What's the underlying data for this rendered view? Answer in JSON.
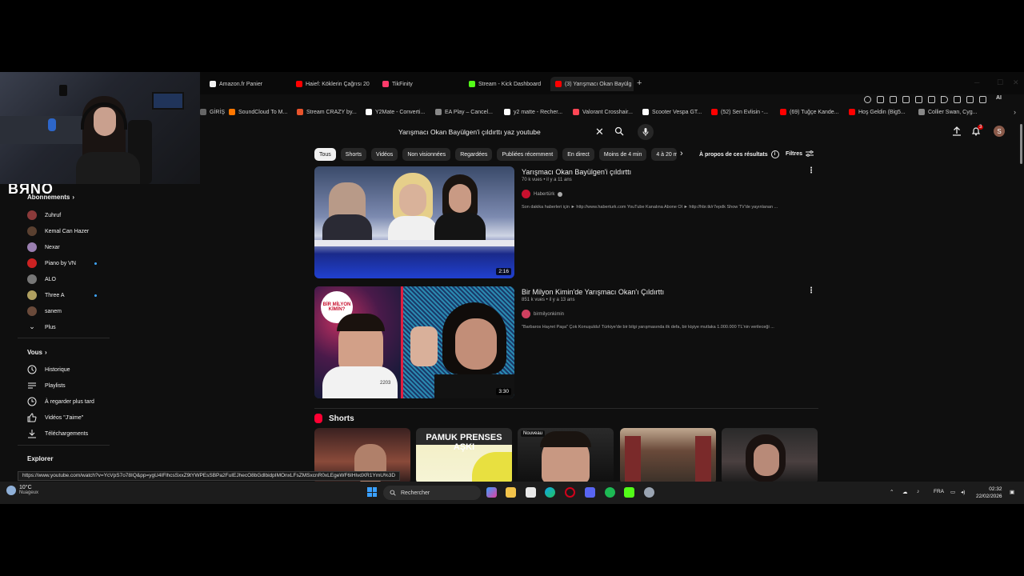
{
  "browser": {
    "tabs": [
      {
        "label": "Amazon.fr Panier",
        "color": "#f3f3f3"
      },
      {
        "label": "Haief: Köklerin Çağrısı 20",
        "color": "#ff0000"
      },
      {
        "label": "TikFinity",
        "color": "#ff3b6b"
      },
      {
        "label": "Stream - Kick Dashboard",
        "color": "#53fc18"
      },
      {
        "label": "(3) Yarışmacı Okan Bayülg",
        "color": "#ff0000"
      }
    ],
    "bookmarks": [
      {
        "label": "GİRİŞ",
        "color": "#666"
      },
      {
        "label": "SoundCloud To M...",
        "color": "#ff7700"
      },
      {
        "label": "Stream CRAZY by...",
        "color": "#e9542c"
      },
      {
        "label": "Y2Mate - Converti...",
        "color": "#ffffff"
      },
      {
        "label": "EA Play – Cancel...",
        "color": "#888"
      },
      {
        "label": "y2 matte - Recher...",
        "color": "#ffffff"
      },
      {
        "label": "Valorant Crosshair...",
        "color": "#ff4655"
      },
      {
        "label": "Scooter Vespa GT...",
        "color": "#ffffff"
      },
      {
        "label": "(52) Sen Evlisin -...",
        "color": "#ff0000"
      },
      {
        "label": "(69) Tuğçe Kande...",
        "color": "#ff0000"
      },
      {
        "label": "Hoş Geldin (Big5...",
        "color": "#ff0000"
      },
      {
        "label": "Collier Swan, Cyg...",
        "color": "#888"
      }
    ],
    "toolbar_ai": "AI"
  },
  "youtube": {
    "search_value": "Yarışmacı Okan Bayülgen'i çıldırttı yaz youtube",
    "notif_count": "3",
    "avatar_letter": "S",
    "chips": [
      "Tous",
      "Shorts",
      "Vidéos",
      "Non visionnées",
      "Regardées",
      "Publiées récemment",
      "En direct",
      "Moins de 4 min",
      "4 à 20 m"
    ],
    "about_results": "À propos de ces résultats",
    "filters": "Filtres",
    "sidebar": {
      "subscriptions_title": "Abonnements",
      "subscriptions": [
        {
          "label": "Zuhruf",
          "color": "#8b3a3a",
          "dot": false
        },
        {
          "label": "Kemal Can Hazer",
          "color": "#5a4030",
          "dot": false
        },
        {
          "label": "Nexar",
          "color": "#9a7fb0",
          "dot": false
        },
        {
          "label": "Piano by VN",
          "color": "#c22",
          "dot": true
        },
        {
          "label": "ALO",
          "color": "#777",
          "dot": false
        },
        {
          "label": "Three A",
          "color": "#b0a060",
          "dot": true
        },
        {
          "label": "sanem",
          "color": "#6a4a3a",
          "dot": false
        },
        {
          "label": "Plus",
          "color": "",
          "dot": false
        }
      ],
      "you_title": "Vous",
      "you_items": [
        "Historique",
        "Playlists",
        "À regarder plus tard",
        "Vidéos \"J'aime\"",
        "Téléchargements"
      ],
      "explore_title": "Explorer"
    },
    "results": [
      {
        "title": "Yarışmacı Okan Bayülgen'i çıldırttı",
        "meta": "70 k vues • il y a 11 ans",
        "channel": "Habertürk",
        "channel_color": "#c8102e",
        "verified": true,
        "description": "Son dakika haberleri için ► http://www.haberturk.com YouTube Kanalına Abone Ol ► http://hbr.tk/r7epdk Show TV'de yayınlanan ...",
        "duration": "2:16"
      },
      {
        "title": "Bir Milyon Kimin'de Yarışmacı Okan'ı Çıldırttı",
        "meta": "851 k vues • il y a 13 ans",
        "channel": "birmilyonkimin",
        "channel_color": "#d04060",
        "verified": false,
        "description": "\"Barbaros Hayret Paşa\" Çok Konuşuldu! Türkiye'de bir bilgi yarışmasında ilk defa, bir kişiye mutlaka 1.000.000 TL'nin verileceği ...",
        "duration": "3:30"
      }
    ],
    "shorts_title": "Shorts",
    "shorts": [
      {
        "badge": "",
        "text": ""
      },
      {
        "badge": "",
        "text": "PAMUK PRENSES AŞKI"
      },
      {
        "badge": "Nouveau",
        "text": ""
      },
      {
        "badge": "",
        "text": ""
      },
      {
        "badge": "",
        "text": ""
      }
    ],
    "thumb1_logo": "BİR MİLYON KİMİN?",
    "thumb1_number": "2203"
  },
  "overlay": {
    "logo_text": "BЯNO"
  },
  "status_url": "https://www.youtube.com/watch?v=YcVpS7o78IQ&pp=ygU4IFlhcsSxxZ9tYWPEsSBPa2FuIEJhecO8bGdlbidpIMOnxLFsZMSxcnR0xLEgeWF6IHlvdXR1YmU%3D",
  "taskbar": {
    "weather_temp": "10°C",
    "weather_desc": "Nuageux",
    "search_placeholder": "Rechercher",
    "lang": "FRA",
    "time": "02:32",
    "date": "22/02/2026"
  }
}
